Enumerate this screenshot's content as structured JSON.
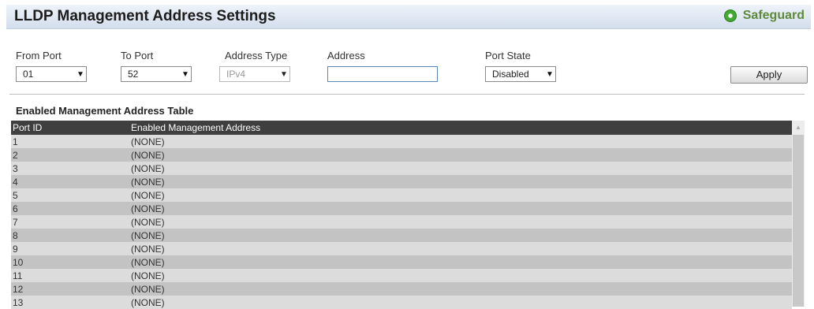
{
  "header": {
    "title": "LLDP Management Address Settings",
    "safeguard_label": "Safeguard",
    "safeguard_color": "#44a832"
  },
  "form": {
    "from_port": {
      "label": "From Port",
      "value": "01"
    },
    "to_port": {
      "label": "To Port",
      "value": "52"
    },
    "address_type": {
      "label": "Address Type",
      "value": "IPv4"
    },
    "address": {
      "label": "Address",
      "value": ""
    },
    "port_state": {
      "label": "Port State",
      "value": "Disabled"
    },
    "apply_label": "Apply"
  },
  "table": {
    "title": "Enabled Management Address Table",
    "columns": [
      "Port ID",
      "Enabled Management Address"
    ],
    "rows": [
      {
        "port": "1",
        "address": "(NONE)"
      },
      {
        "port": "2",
        "address": "(NONE)"
      },
      {
        "port": "3",
        "address": "(NONE)"
      },
      {
        "port": "4",
        "address": "(NONE)"
      },
      {
        "port": "5",
        "address": "(NONE)"
      },
      {
        "port": "6",
        "address": "(NONE)"
      },
      {
        "port": "7",
        "address": "(NONE)"
      },
      {
        "port": "8",
        "address": "(NONE)"
      },
      {
        "port": "9",
        "address": "(NONE)"
      },
      {
        "port": "10",
        "address": "(NONE)"
      },
      {
        "port": "11",
        "address": "(NONE)"
      },
      {
        "port": "12",
        "address": "(NONE)"
      },
      {
        "port": "13",
        "address": "(NONE)"
      }
    ]
  }
}
